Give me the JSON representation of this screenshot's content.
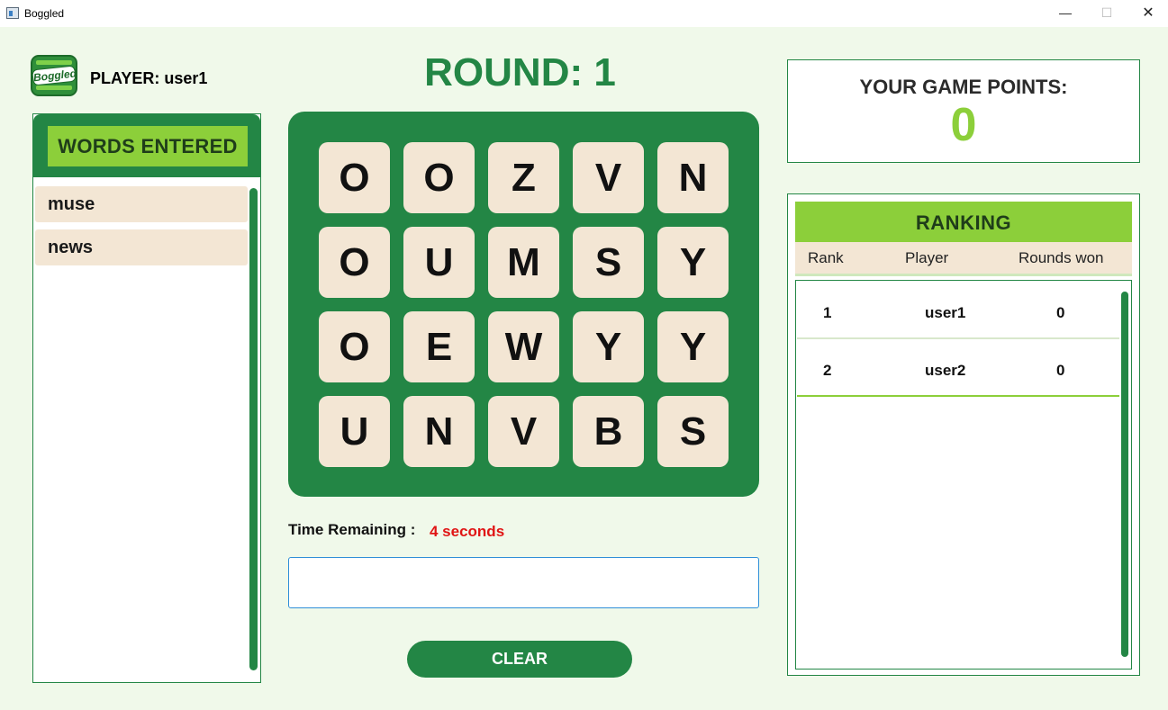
{
  "window": {
    "title": "Boggled",
    "minimize": "—",
    "maximize": "☐",
    "close": "✕"
  },
  "header": {
    "logo_text": "Boggled",
    "player_label": "PLAYER: user1",
    "round_label": "ROUND: 1"
  },
  "words_panel": {
    "title": "WORDS ENTERED",
    "words": [
      "muse",
      "news"
    ]
  },
  "board": {
    "letters": [
      "O",
      "O",
      "Z",
      "V",
      "N",
      "O",
      "U",
      "M",
      "S",
      "Y",
      "O",
      "E",
      "W",
      "Y",
      "Y",
      "U",
      "N",
      "V",
      "B",
      "S"
    ]
  },
  "timer": {
    "label": "Time Remaining :",
    "value": "4 seconds"
  },
  "input": {
    "value": "",
    "placeholder": ""
  },
  "clear_button": "CLEAR",
  "points": {
    "label": "YOUR GAME POINTS:",
    "value": "0"
  },
  "ranking": {
    "title": "RANKING",
    "columns": [
      "Rank",
      "Player",
      "Rounds won"
    ],
    "rows": [
      {
        "rank": "1",
        "player": "user1",
        "won": "0"
      },
      {
        "rank": "2",
        "player": "user2",
        "won": "0"
      }
    ]
  },
  "colors": {
    "primary_green": "#238645",
    "accent_green": "#8ccf3a",
    "tile": "#f3e6d4",
    "background": "#f0f9ea",
    "timer_red": "#e01414"
  }
}
